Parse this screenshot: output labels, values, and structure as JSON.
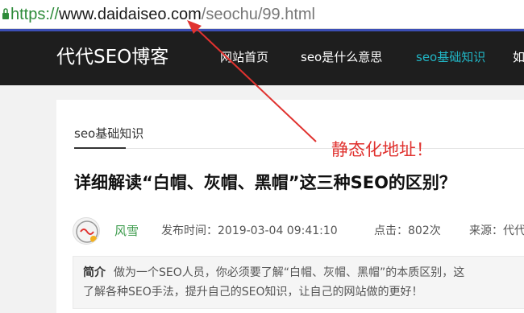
{
  "browser": {
    "url_scheme": "https://",
    "url_domain": "www.daidaiseo.com",
    "url_path": "/seochu/99.html"
  },
  "site": {
    "logo_text": "代代SEO博客",
    "nav": [
      {
        "label": "网站首页"
      },
      {
        "label": "seo是什么意思"
      },
      {
        "label": "seo基础知识",
        "active": true
      },
      {
        "label": "如"
      }
    ]
  },
  "article": {
    "breadcrumb": "seo基础知识",
    "title": "详细解读“白帽、灰帽、黑帽”这三种SEO的区别？",
    "author": "风雪",
    "date_label": "发布时间：",
    "date_value": "2019-03-04 09:41:10",
    "clicks_label": "点击：",
    "clicks_value": "802次",
    "source_label": "来源：",
    "source_value": "代代",
    "summary_label": "简介",
    "summary_line1": "做为一个SEO人员，你必须要了解“白帽、灰帽、黑帽”的本质区别，这",
    "summary_line2": "了解各种SEO手法，提升自己的SEO知识，让自己的网站做的更好！"
  },
  "annotation": {
    "text": "静态化地址！"
  },
  "colors": {
    "url_scheme": "#2e8b3a",
    "header_bg": "#1e1e1e",
    "nav_active": "#21b5c4",
    "author": "#3a9a4a",
    "annotation": "#e0322f"
  }
}
